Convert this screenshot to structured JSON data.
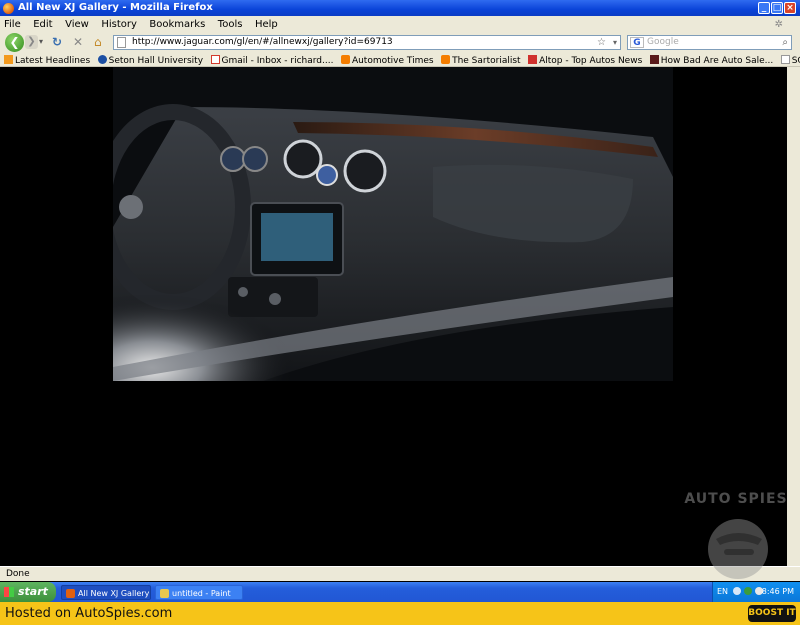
{
  "window": {
    "title": "All New XJ Gallery - Mozilla Firefox",
    "buttons": {
      "minimize": "_",
      "maximize": "□",
      "close": "×"
    }
  },
  "menu": [
    "File",
    "Edit",
    "View",
    "History",
    "Bookmarks",
    "Tools",
    "Help"
  ],
  "nav": {
    "url": "http://www.jaguar.com/gl/en/#/allnewxj/gallery?id=69713",
    "search_placeholder": "Google",
    "search_engine": "G"
  },
  "bookmarks": [
    {
      "label": "Latest Headlines",
      "icon": "rss-icon",
      "color": "#f39a1e"
    },
    {
      "label": "Seton Hall University",
      "icon": "seton-hall-icon",
      "color": "#1c4fa3"
    },
    {
      "label": "Gmail - Inbox - richard....",
      "icon": "gmail-icon",
      "color": "#d33a2c"
    },
    {
      "label": "Automotive Times",
      "icon": "blogger-icon",
      "color": "#f57d00"
    },
    {
      "label": "The Sartorialist",
      "icon": "blogger-icon",
      "color": "#f57d00"
    },
    {
      "label": "Altop - Top Autos News",
      "icon": "altop-icon",
      "color": "#d0312d"
    },
    {
      "label": "How Bad Are Auto Sale...",
      "icon": "page-icon",
      "color": "#5a1a1a"
    },
    {
      "label": "SCOUTING NY - www.s...",
      "icon": "page-icon",
      "color": "#ffffff"
    }
  ],
  "status": "Done",
  "taskbar": {
    "start": "start",
    "tasks": [
      {
        "label": "All New XJ Gallery - M...",
        "icon": "firefox-icon",
        "color": "#e06010"
      },
      {
        "label": "untitled - Paint",
        "icon": "paint-icon",
        "color": "#e8c850"
      }
    ],
    "lang": "EN",
    "clock": "8:46 PM"
  },
  "footer": {
    "hosted": "Hosted on AutoSpies.com",
    "boost": "BOOST IT"
  },
  "watermark": "AUTO SPIES"
}
